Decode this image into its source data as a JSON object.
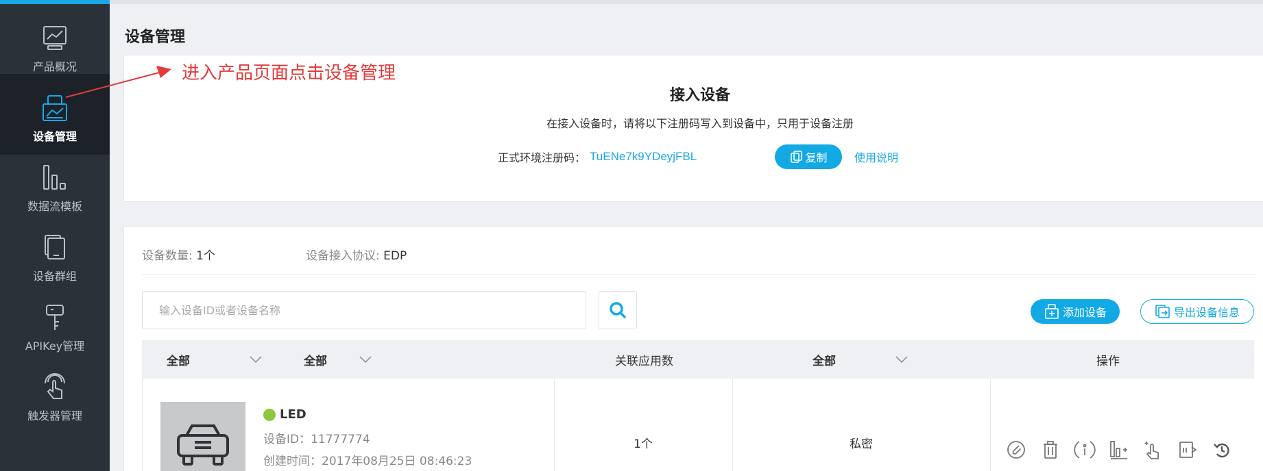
{
  "sidebar": {
    "items": [
      {
        "label": "产品概况",
        "icon": "chart-screen-icon"
      },
      {
        "label": "设备管理",
        "icon": "device-box-icon",
        "active": true
      },
      {
        "label": "数据流模板",
        "icon": "datastream-bars-icon"
      },
      {
        "label": "设备群组",
        "icon": "device-group-icon"
      },
      {
        "label": "APIKey管理",
        "icon": "key-icon"
      },
      {
        "label": "触发器管理",
        "icon": "trigger-hand-icon"
      }
    ]
  },
  "page": {
    "title": "设备管理"
  },
  "annotation": {
    "text": "进入产品页面点击设备管理",
    "color": "#e33b3b"
  },
  "access": {
    "title": "接入设备",
    "description": "在接入设备时，请将以下注册码写入到设备中，只用于设备注册",
    "reg_label": "正式环境注册码：",
    "reg_code": "TuENe7k9YDeyjFBL",
    "copy_label": "复制",
    "help_label": "使用说明"
  },
  "devices": {
    "count_label": "设备数量: ",
    "count_value": "1个",
    "protocol_label": "设备接入协议: ",
    "protocol_value": "EDP",
    "search_placeholder": "输入设备ID或者设备名称",
    "add_label": "添加设备",
    "export_label": "导出设备信息",
    "columns": {
      "filter1": "全部",
      "filter2": "全部",
      "apps": "关联应用数",
      "filter3": "全部",
      "ops": "操作"
    },
    "rows": [
      {
        "name": "LED",
        "status_color": "#8dc63f",
        "id_text": "设备ID：11777774",
        "created_text": "创建时间：2017年08月25日 08:46:23",
        "apps": "1个",
        "privacy": "私密"
      }
    ]
  },
  "colors": {
    "accent": "#12a9e4",
    "sidebar_bg": "#2a3138",
    "sidebar_active": "#1c2228"
  }
}
